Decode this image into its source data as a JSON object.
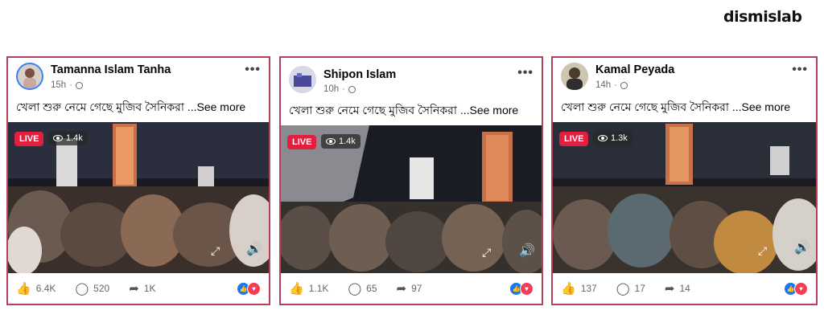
{
  "brand": "dismislab",
  "posts": [
    {
      "name": "Tamanna Islam Tanha",
      "time": "15h",
      "caption": "খেলা শুরু নেমে গেছে মুজিব সৈনিকরা",
      "see_more": " ...See more",
      "live_label": "LIVE",
      "viewers": "1.4k",
      "likes": "6.4K",
      "comments": "520",
      "shares": "1K"
    },
    {
      "name": "Shipon Islam",
      "time": "10h",
      "caption": "খেলা শুরু নেমে গেছে মুজিব সৈনিকরা",
      "see_more": " ...See more",
      "live_label": "LIVE",
      "viewers": "1.4k",
      "likes": "1.1K",
      "comments": "65",
      "shares": "97"
    },
    {
      "name": "Kamal Peyada",
      "time": "14h",
      "caption": "খেলা শুরু নেমে গেছে মুজিব সৈনিকরা",
      "see_more": " ...See more",
      "live_label": "LIVE",
      "viewers": "1.3k",
      "likes": "137",
      "comments": "17",
      "shares": "14"
    }
  ],
  "colors": {
    "card_border": "#b3415a",
    "live_badge": "#e41e3f",
    "like_react": "#1877f2",
    "love_react": "#f33e58"
  }
}
